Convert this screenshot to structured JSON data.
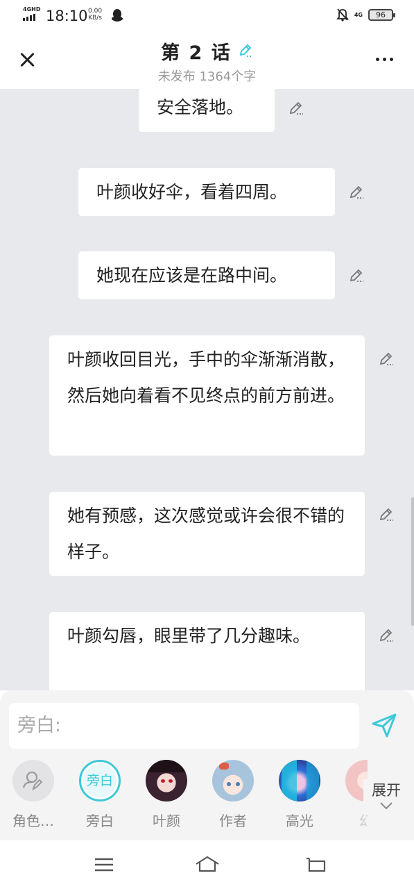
{
  "status_bar": {
    "network": "4GHD",
    "time": "18:10",
    "speed_value": "0.00",
    "speed_unit": "KB/s",
    "network2": "4G",
    "battery": "96"
  },
  "header": {
    "title": "第 2 话",
    "subtitle": "未发布 1364个字"
  },
  "messages": [
    {
      "text": "安全落地。"
    },
    {
      "text": "叶颜收好伞，看着四周。"
    },
    {
      "text": "她现在应该是在路中间。"
    },
    {
      "text": "叶颜收回目光，手中的伞渐渐消散，然后她向着看不见终点的前方前进。"
    },
    {
      "text": "她有预感，这次感觉或许会很不错的样子。"
    },
    {
      "text": "叶颜勾唇，眼里带了几分趣味。"
    }
  ],
  "composer": {
    "placeholder": "旁白:"
  },
  "roles": [
    {
      "name": "角色…"
    },
    {
      "name": "旁白",
      "avatar_text": "旁白"
    },
    {
      "name": "叶颜"
    },
    {
      "name": "作者"
    },
    {
      "name": "高光"
    },
    {
      "name": "幻"
    }
  ],
  "expand": {
    "label": "展开"
  },
  "colors": {
    "accent": "#3ec9d8",
    "background": "#e8e9ec",
    "text": "#222222",
    "muted": "#999999"
  }
}
